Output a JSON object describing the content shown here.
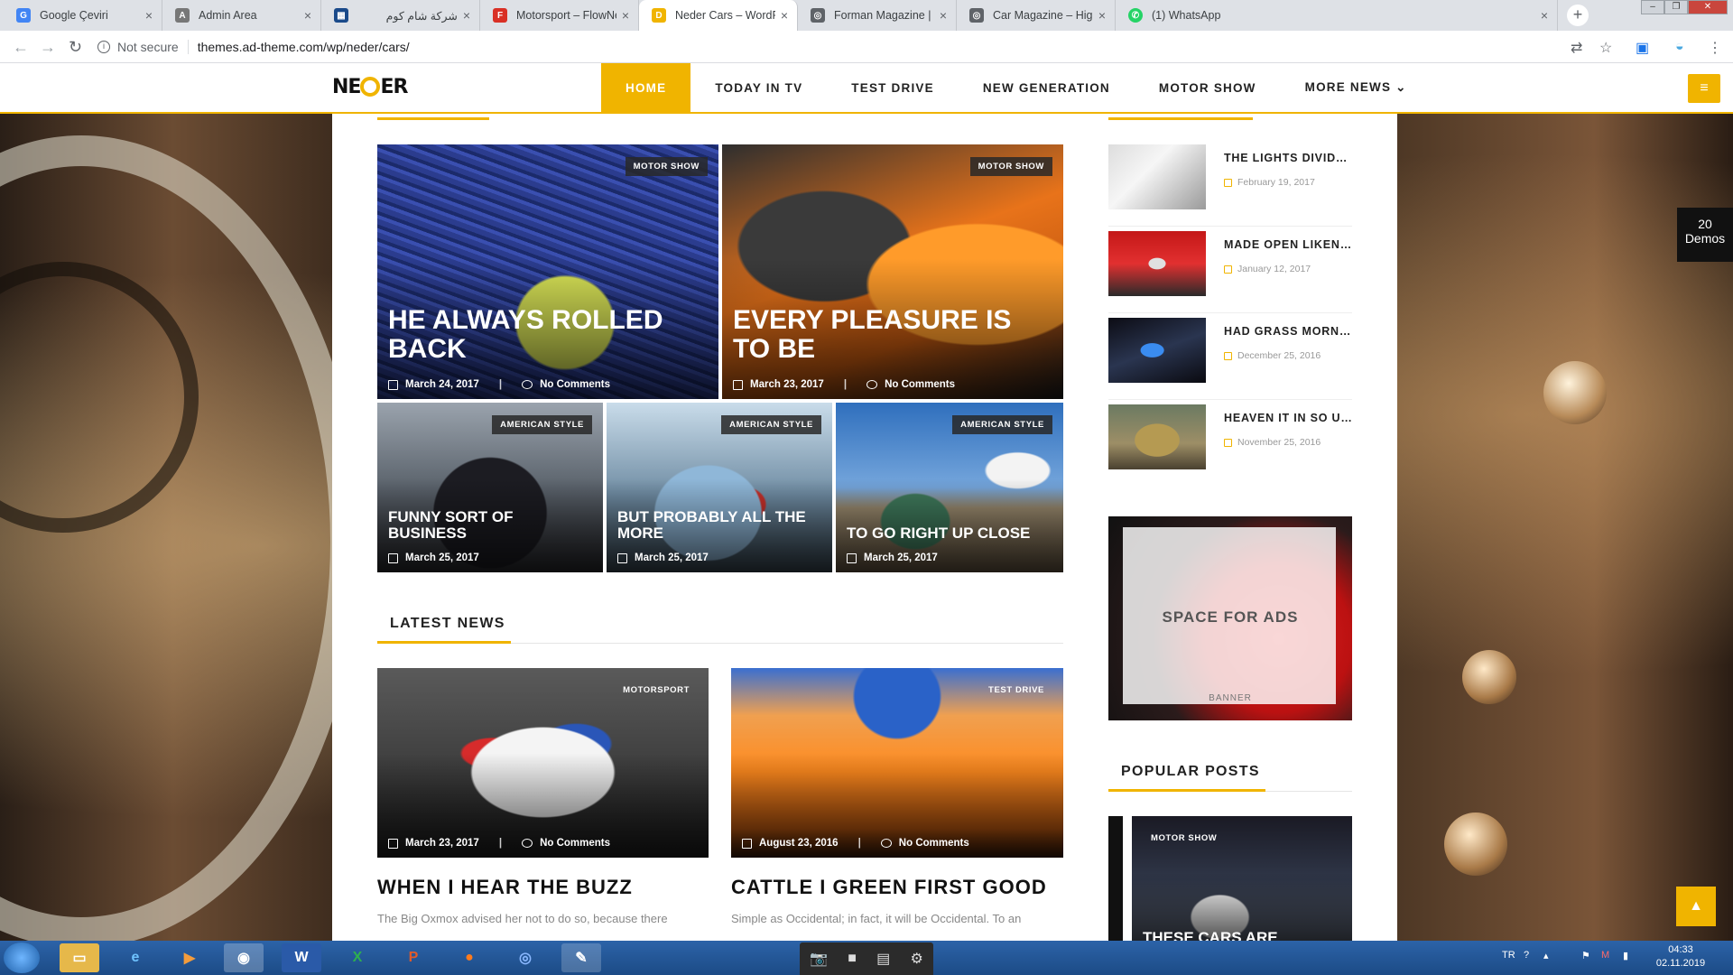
{
  "browser": {
    "tabs": [
      {
        "label": "Google Çeviri",
        "color": "#4285f4",
        "glyph": "G"
      },
      {
        "label": "Admin Area",
        "color": "#777777",
        "glyph": "A"
      },
      {
        "label": "شركة شام كوم",
        "color": "#1a4a8a",
        "glyph": "▦"
      },
      {
        "label": "Motorsport – FlowNews – N",
        "color": "#d93025",
        "glyph": "F"
      },
      {
        "label": "Neder Cars – WordPress Ne",
        "color": "#f0b400",
        "glyph": "D"
      },
      {
        "label": "Forman Magazine | Just ano",
        "color": "#5f6368",
        "glyph": "◎"
      },
      {
        "label": "Car Magazine – Higher Plac",
        "color": "#5f6368",
        "glyph": "◎"
      },
      {
        "label": "(1) WhatsApp",
        "color": "#25d366",
        "glyph": "✆"
      }
    ],
    "security": "Not secure",
    "url": "themes.ad-theme.com/wp/neder/cars/"
  },
  "site": {
    "logo_left": "NE",
    "logo_right": "ER",
    "menu": [
      "HOME",
      "TODAY IN TV",
      "TEST DRIVE",
      "NEW GENERATION",
      "MOTOR SHOW",
      "MORE NEWS ⌄"
    ]
  },
  "featured": [
    {
      "badge": "MOTOR SHOW",
      "title": "HE ALWAYS ROLLED BACK",
      "date": "March 24, 2017",
      "comments": "No Comments"
    },
    {
      "badge": "MOTOR SHOW",
      "title": "EVERY PLEASURE IS TO BE",
      "date": "March 23, 2017",
      "comments": "No Comments"
    },
    {
      "badge": "AMERICAN STYLE",
      "title": "FUNNY SORT OF BUSINESS",
      "date": "March 25, 2017"
    },
    {
      "badge": "AMERICAN STYLE",
      "title": "BUT PROBABLY ALL THE MORE",
      "date": "March 25, 2017"
    },
    {
      "badge": "AMERICAN STYLE",
      "title": "TO GO RIGHT UP CLOSE",
      "date": "March 25, 2017"
    }
  ],
  "latest": {
    "heading": "LATEST NEWS",
    "items": [
      {
        "badge": "MOTORSPORT",
        "date": "March 23, 2017",
        "comments": "No Comments",
        "title": "WHEN I HEAR THE BUZZ",
        "excerpt": "The Big Oxmox advised her not to do so, because there"
      },
      {
        "badge": "TEST DRIVE",
        "date": "August 23, 2016",
        "comments": "No Comments",
        "title": "CATTLE I GREEN FIRST GOOD",
        "excerpt": "Simple as Occidental; in fact, it will be Occidental. To an"
      }
    ]
  },
  "sidebar": {
    "recent": [
      {
        "title": "THE LIGHTS DIVIDED",
        "date": "February 19, 2017"
      },
      {
        "title": "MADE OPEN LIKENE…",
        "date": "January 12, 2017"
      },
      {
        "title": "HAD GRASS MORNI…",
        "date": "December 25, 2016"
      },
      {
        "title": "HEAVEN IT IN SO U…",
        "date": "November 25, 2016"
      }
    ],
    "ads": {
      "text": "SPACE FOR ADS",
      "banner": "BANNER"
    },
    "popular_heading": "POPULAR POSTS",
    "popular_badge": "MOTOR SHOW",
    "popular_title": "THESE CARS ARE"
  },
  "demos": {
    "count": "20",
    "label": "Demos"
  },
  "taskbar": {
    "lang": "TR",
    "time": "04:33",
    "date": "02.11.2019"
  },
  "colors": {
    "accent": "#f0b400"
  }
}
